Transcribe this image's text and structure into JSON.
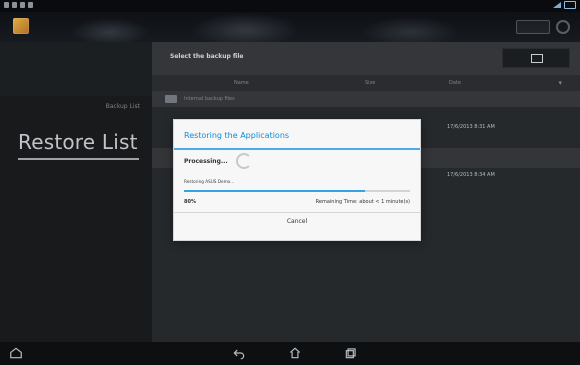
{
  "left_panel": {
    "backup_list": "Backup List",
    "restore_list": "Restore List"
  },
  "right_panel": {
    "title": "Select the backup file",
    "columns": {
      "name": "Name",
      "size": "Size",
      "date": "Date"
    },
    "folder_label": "Internal backup files",
    "rows": [
      {
        "date": "17/6/2013 8:31 AM"
      },
      {
        "date": "17/6/2013 8:34 AM"
      }
    ]
  },
  "dialog": {
    "title": "Restoring the Applications",
    "processing": "Processing...",
    "status": "Restoring ASUS Demo...",
    "progress_percent": 80,
    "percent_text": "80%",
    "remaining_text": "Remaining Time: about  < 1 minute(s)",
    "cancel": "Cancel"
  }
}
